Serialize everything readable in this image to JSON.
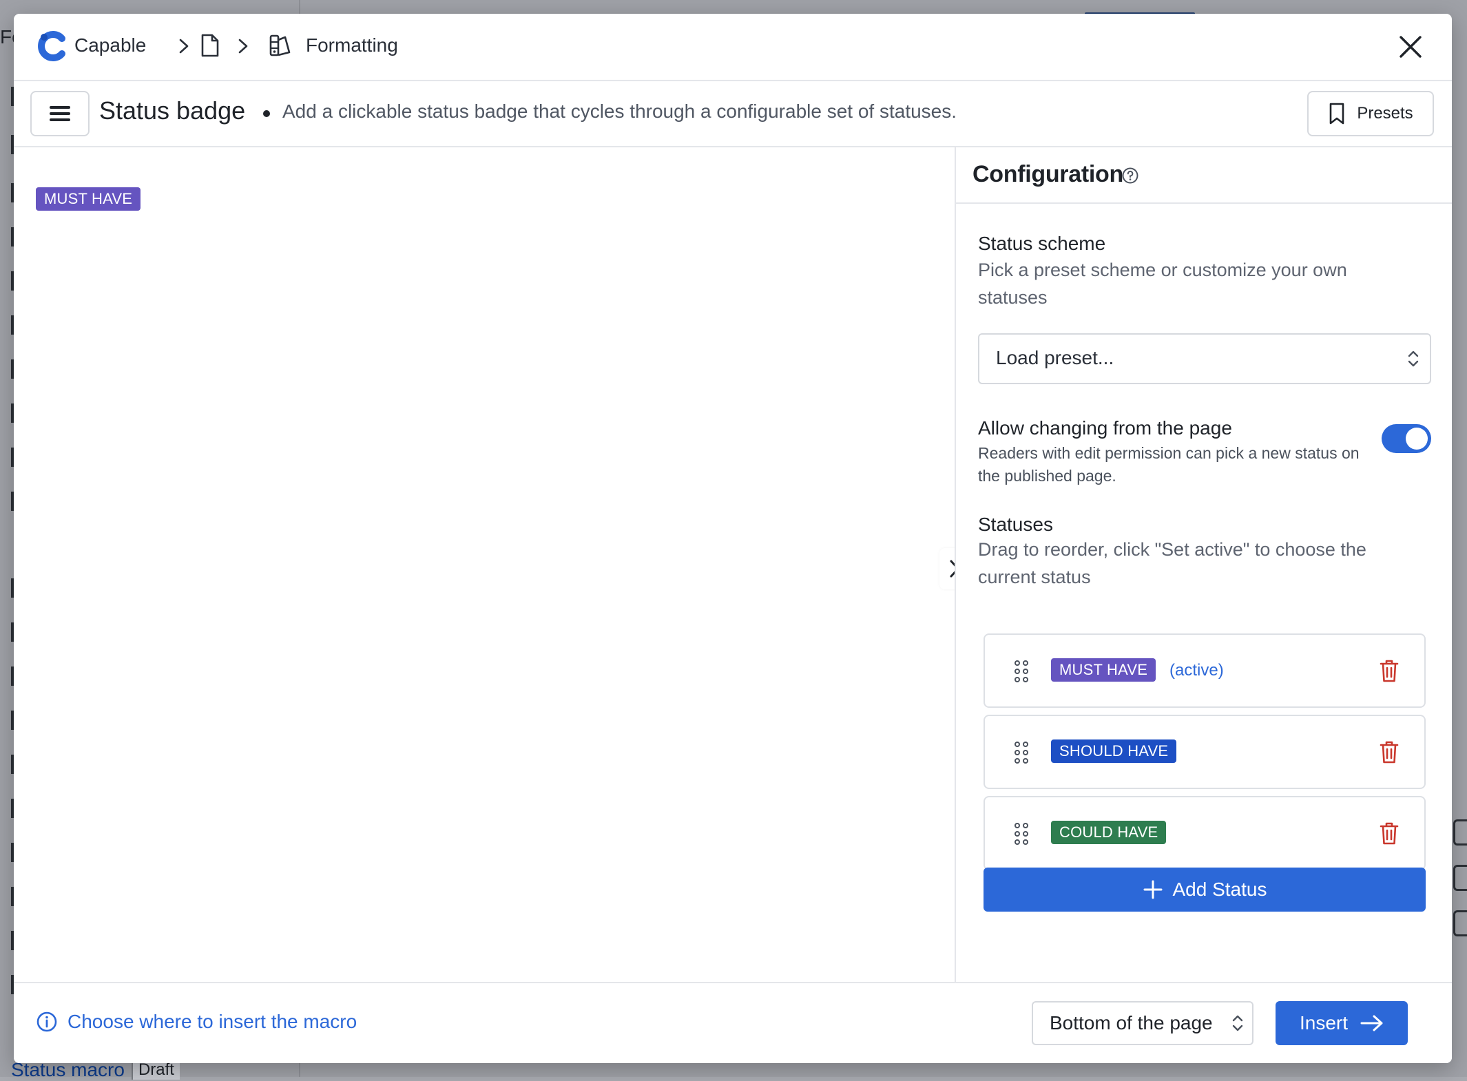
{
  "background": {
    "left_text": "Fo",
    "bottom_item": "Status macro",
    "bottom_badge": "Draft"
  },
  "breadcrumb": {
    "app": "Capable",
    "section": "Formatting"
  },
  "header": {
    "title": "Status badge",
    "description": "Add a clickable status badge that cycles through a configurable set of statuses.",
    "presets_label": "Presets"
  },
  "preview": {
    "badge_label": "MUST HAVE",
    "badge_color": "#6554c0"
  },
  "config": {
    "title": "Configuration",
    "status_scheme": {
      "label": "Status scheme",
      "description": "Pick a preset scheme or customize your own statuses",
      "select_value": "Load preset..."
    },
    "allow_change": {
      "label": "Allow changing from the page",
      "description": "Readers with edit permission can pick a new status on the published page.",
      "enabled": true
    },
    "statuses": {
      "label": "Statuses",
      "description": "Drag to reorder, click \"Set active\" to choose the current status",
      "items": [
        {
          "label": "MUST HAVE",
          "color": "#6554c0",
          "active": true,
          "active_text": "(active)"
        },
        {
          "label": "SHOULD HAVE",
          "color": "#1d4fc4",
          "active": false
        },
        {
          "label": "COULD HAVE",
          "color": "#2e7d4f",
          "active": false
        }
      ],
      "add_label": "Add Status"
    }
  },
  "footer": {
    "info_text": "Choose where to insert the macro",
    "position_value": "Bottom of the page",
    "insert_label": "Insert"
  },
  "colors": {
    "accent": "#2c68d8",
    "danger": "#c9372c"
  }
}
